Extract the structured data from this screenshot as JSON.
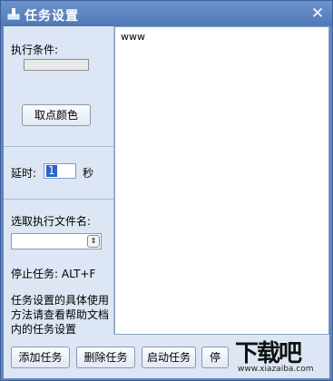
{
  "window": {
    "title": "任务设置",
    "close_symbol": "✕"
  },
  "left": {
    "condition_label": "执行条件:",
    "pick_color_button": "取点颜色",
    "delay_label": "延时:",
    "delay_value": "1",
    "delay_unit": "秒",
    "select_file_label": "选取执行文件名:",
    "file_value": "",
    "stop_label": "停止任务: ALT+F",
    "help_text": "任务设置的具体使用方法请查看帮助文档内的任务设置"
  },
  "editor": {
    "content": "www"
  },
  "buttons": {
    "add_task": "添加任务",
    "delete_task": "删除任务",
    "start_task": "启动任务",
    "partial_fourth": "停"
  },
  "watermark": {
    "logo_text": "下载吧",
    "url": "www.xiazaiba.com"
  },
  "colors": {
    "title_bar": "#5a82bf",
    "panel": "#dce6f4"
  }
}
